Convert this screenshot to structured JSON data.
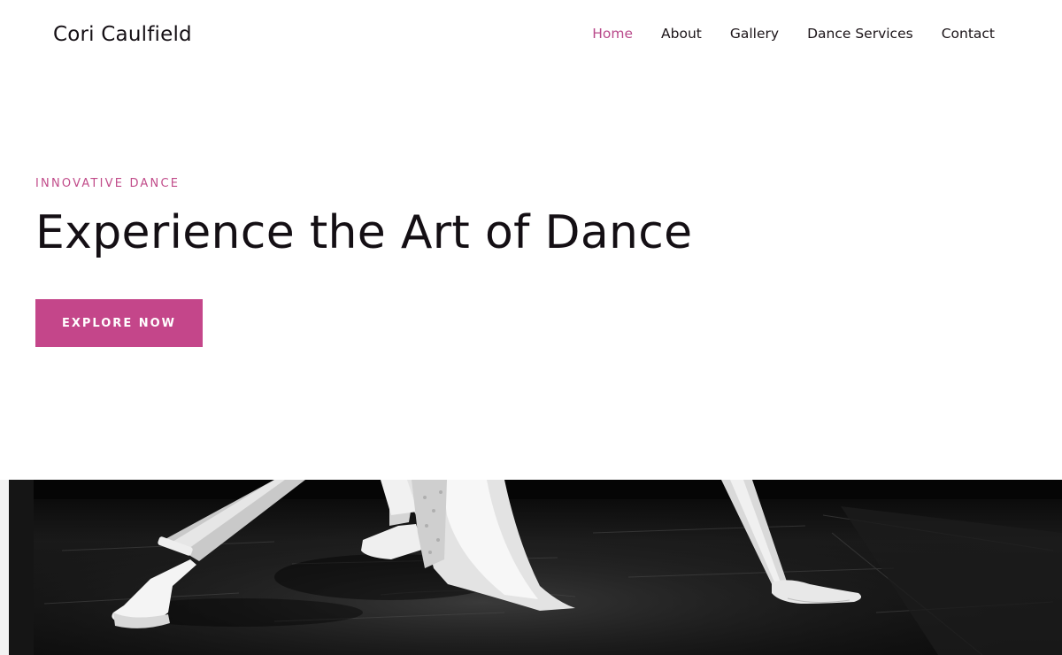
{
  "header": {
    "site_title": "Cori Caulfield",
    "nav": [
      {
        "label": "Home",
        "active": true
      },
      {
        "label": "About",
        "active": false
      },
      {
        "label": "Gallery",
        "active": false
      },
      {
        "label": "Dance Services",
        "active": false
      },
      {
        "label": "Contact",
        "active": false
      }
    ]
  },
  "hero": {
    "eyebrow": "INNOVATIVE DANCE",
    "headline": "Experience the Art of Dance",
    "cta_label": "EXPLORE NOW"
  },
  "colors": {
    "accent": "#c4468a",
    "text": "#140f14",
    "background": "#ffffff"
  },
  "image": {
    "description_icon": "dance-photo"
  }
}
